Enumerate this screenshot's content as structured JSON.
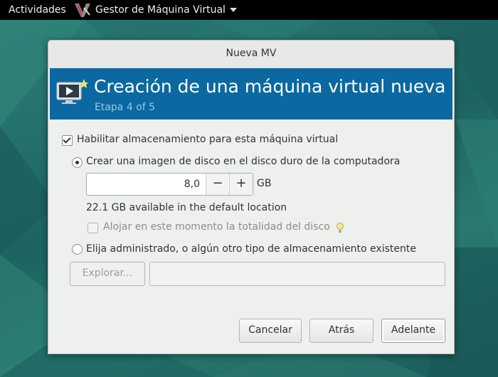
{
  "topbar": {
    "activities": "Actividades",
    "app_label": "Gestor de Máquina Virtual"
  },
  "dialog": {
    "title": "Nueva MV",
    "banner_title": "Creación de una máquina virtual nueva",
    "banner_subtitle": "Etapa 4 of 5"
  },
  "storage": {
    "enable_label": "Habilitar almacenamiento para esta máquina virtual",
    "enable_checked": true,
    "create_label": "Crear una imagen de disco en el disco duro de la computadora",
    "disk_size": "8,0",
    "decrement": "−",
    "increment": "+",
    "unit": "GB",
    "available": "22.1 GB available in the default location",
    "allocate_label": "Alojar en este momento la totalidad del disco",
    "existing_label": "Elija administrado, o algún otro tipo de almacenamiento existente",
    "browse_label": "Explorar...",
    "path_value": ""
  },
  "buttons": {
    "cancel": "Cancelar",
    "back": "Atrás",
    "forward": "Adelante"
  },
  "colors": {
    "banner": "#0b68a0",
    "topbar": "#000000"
  },
  "icons": {
    "banner": "monitor-play-icon",
    "hint": "lightbulb-icon"
  }
}
